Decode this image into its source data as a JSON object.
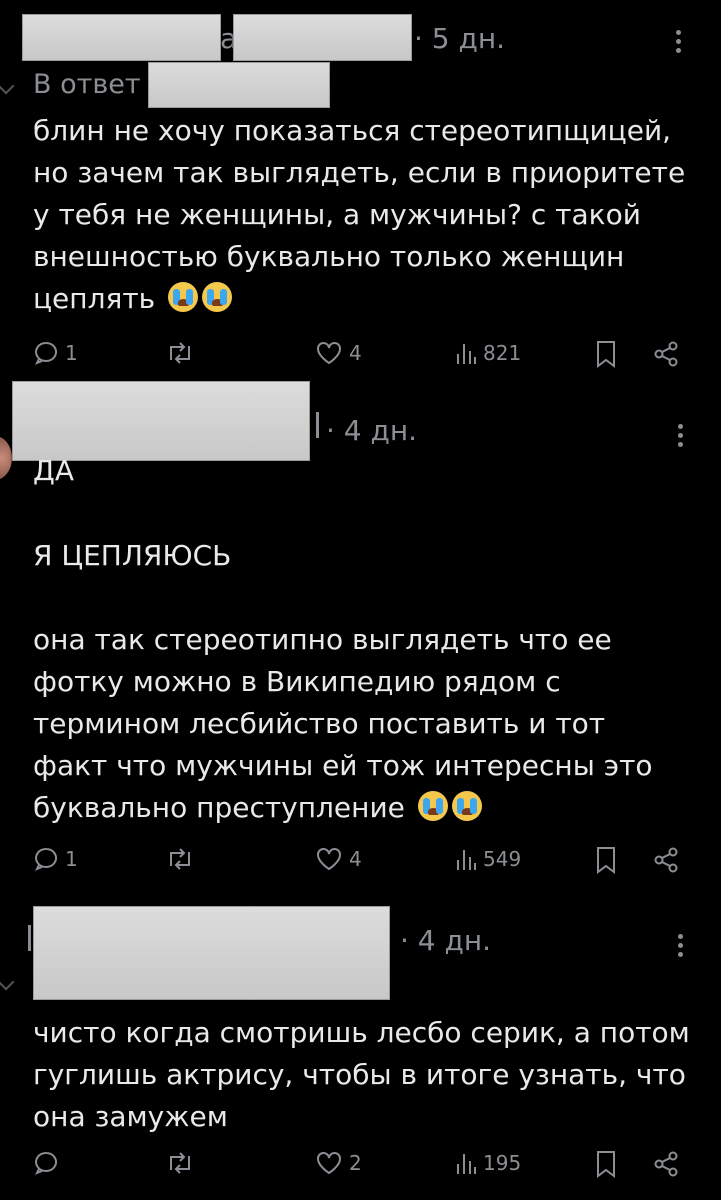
{
  "posts": [
    {
      "time": "· 5 дн.",
      "reply_label": "В ответ",
      "lines": [
        "блин не хочу показаться стереотипщицей,",
        "но зачем так выглядеть, если в приоритете",
        "у тебя не женщины, а мужчины? с такой",
        "внешностью буквально только женщин",
        "цеплять"
      ],
      "replies": "1",
      "likes": "4",
      "views": "821"
    },
    {
      "time": "· 4 дн.",
      "paragraphs": [
        "ДА",
        "Я ЦЕПЛЯЮСЬ"
      ],
      "lines": [
        "она так стереотипно выглядеть что ее",
        "фотку можно в Википедию рядом с",
        "термином лесбийство поставить и тот",
        "факт что мужчины ей тож интересны это",
        "буквально преступление"
      ],
      "replies": "1",
      "likes": "4",
      "views": "549"
    },
    {
      "time": "· 4 дн.",
      "lines": [
        "чисто когда смотришь лесбо серик, а потом",
        "гуглишь актрису, чтобы в итоге узнать, что",
        "она замужем"
      ],
      "replies": "",
      "likes": "2",
      "views": "195"
    }
  ],
  "icons": {
    "reply": "reply-bubble-icon",
    "repost": "repost-icon",
    "like": "heart-icon",
    "views": "views-bar-icon",
    "bookmark": "bookmark-icon",
    "share": "share-icon",
    "more": "more-vertical-icon",
    "emoji": "loudly-crying-face-emoji"
  },
  "colors": {
    "background": "#000000",
    "text": "#e7e9ea",
    "muted": "#8b8f94",
    "censor": "#d2d2d2"
  }
}
